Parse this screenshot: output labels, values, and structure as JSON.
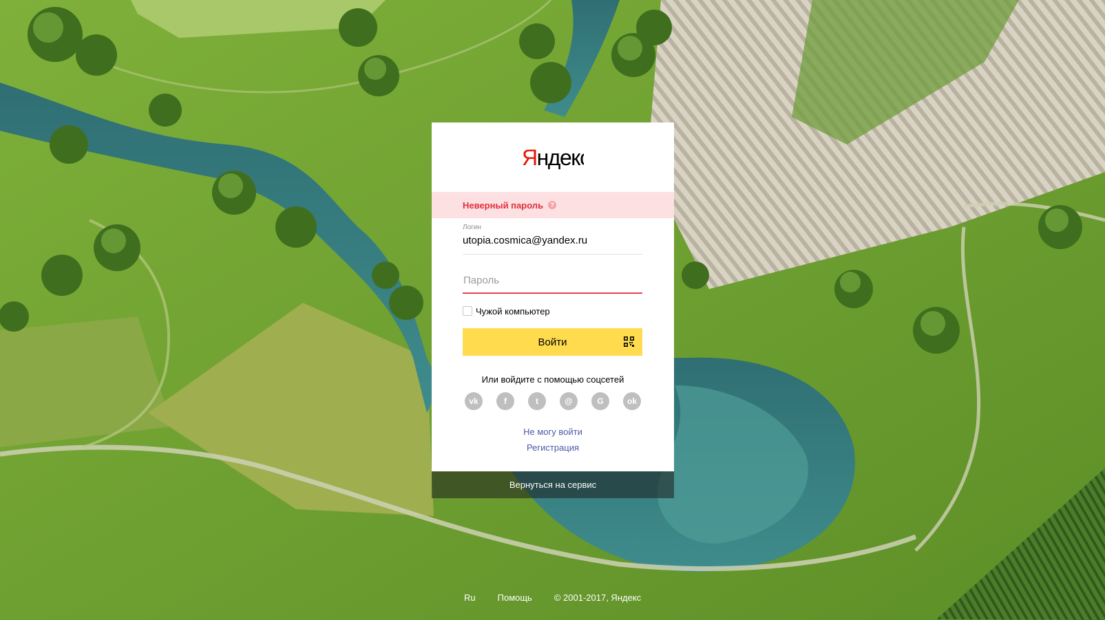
{
  "logo": {
    "text": "Яндекс"
  },
  "error": {
    "text": "Неверный пароль",
    "help_glyph": "?"
  },
  "login_field": {
    "label": "Логин",
    "value": "utopia.cosmica@yandex.ru"
  },
  "password_field": {
    "placeholder": "Пароль"
  },
  "remember": {
    "label": "Чужой компьютер",
    "checked": false
  },
  "submit": {
    "label": "Войти",
    "icon": "qr-code-icon"
  },
  "social": {
    "title": "Или войдите с помощью соцсетей",
    "providers": [
      {
        "name": "vk-icon",
        "glyph": "vk"
      },
      {
        "name": "facebook-icon",
        "glyph": "f"
      },
      {
        "name": "twitter-icon",
        "glyph": "t"
      },
      {
        "name": "mailru-icon",
        "glyph": "@"
      },
      {
        "name": "google-icon",
        "glyph": "G"
      },
      {
        "name": "odnoklassniki-icon",
        "glyph": "ok"
      }
    ]
  },
  "links": {
    "cant_login": "Не могу войти",
    "register": "Регистрация"
  },
  "back": {
    "label": "Вернуться на сервис"
  },
  "footer": {
    "lang": "Ru",
    "help": "Помощь",
    "copyright": "© 2001-2017, Яндекс"
  },
  "colors": {
    "accent": "#ffdb4d",
    "error": "#e0303b",
    "error_bg": "#fde0e2",
    "link": "#4a5aa8",
    "logo_red": "#e61400"
  }
}
